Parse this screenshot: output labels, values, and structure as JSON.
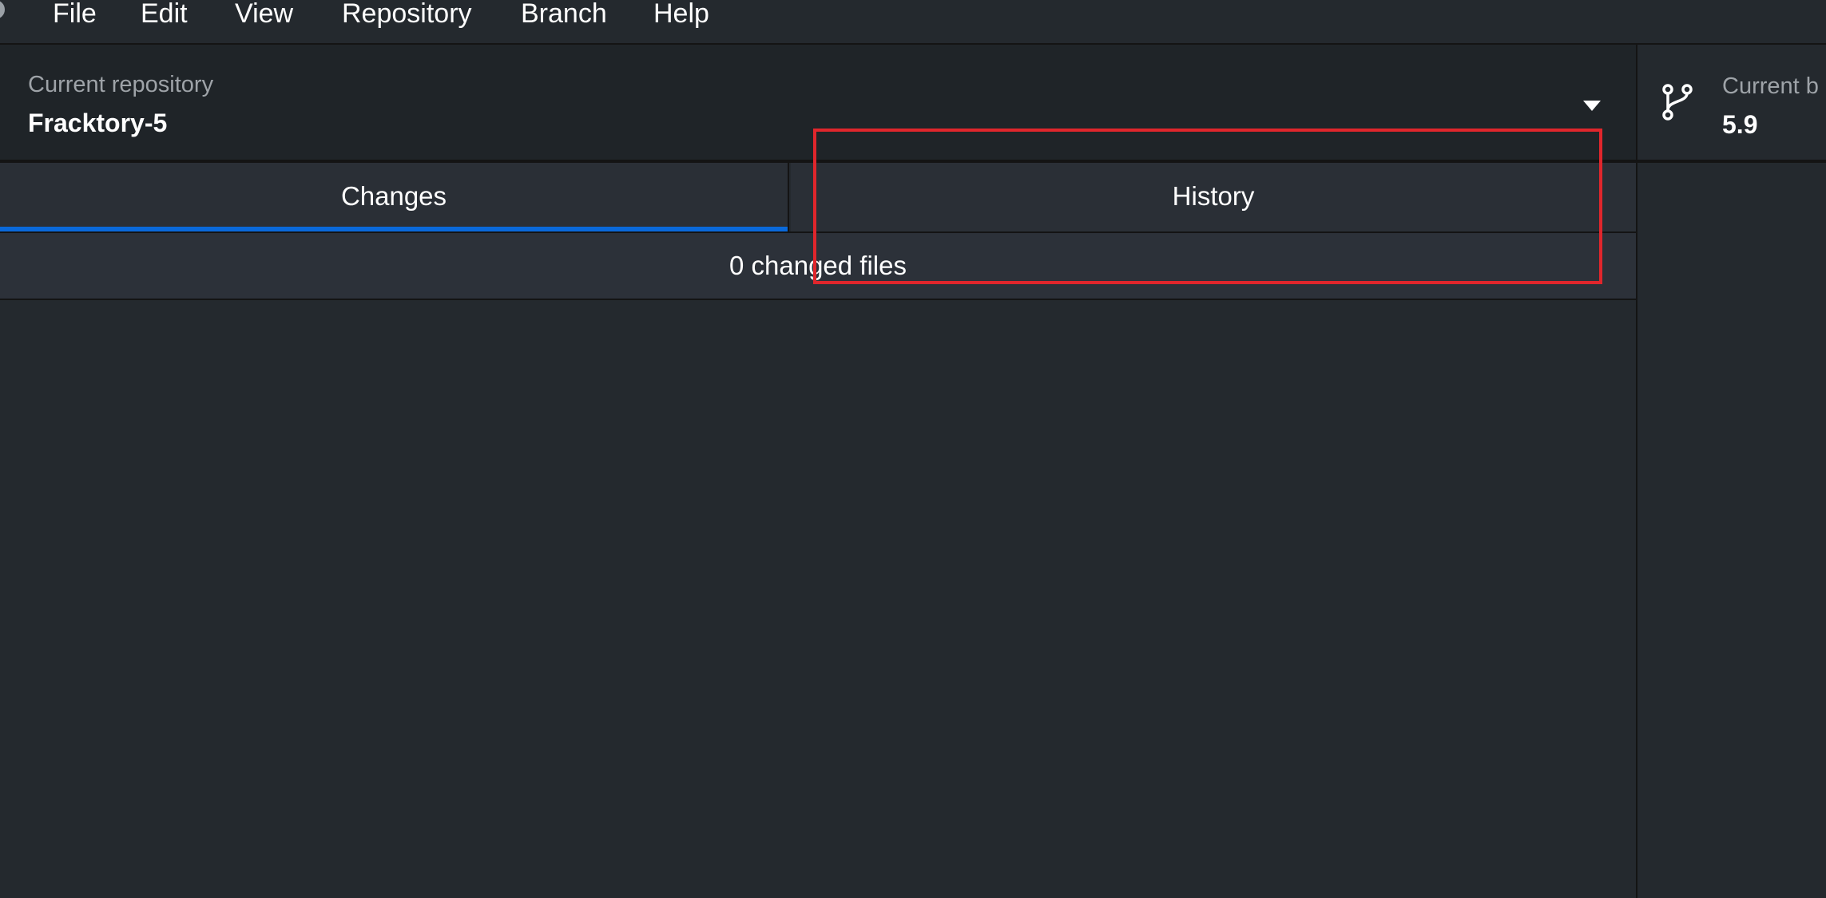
{
  "menubar": {
    "items": [
      {
        "id": "file",
        "label": "File"
      },
      {
        "id": "edit",
        "label": "Edit"
      },
      {
        "id": "view",
        "label": "View"
      },
      {
        "id": "repository",
        "label": "Repository"
      },
      {
        "id": "branch",
        "label": "Branch"
      },
      {
        "id": "help",
        "label": "Help"
      }
    ]
  },
  "toolbar": {
    "repository": {
      "label": "Current repository",
      "value": "Fracktory-5",
      "dropdown_icon": "caret-down-icon"
    },
    "branch": {
      "label": "Current b",
      "value": "5.9",
      "icon": "git-branch-icon"
    }
  },
  "tabs": [
    {
      "id": "changes",
      "label": "Changes",
      "selected": true
    },
    {
      "id": "history",
      "label": "History",
      "selected": false
    }
  ],
  "changes": {
    "summary": "0 changed files"
  },
  "colors": {
    "background": "#24292e",
    "tab_background": "#2a2f36",
    "selected_tab_underline": "#0a69da",
    "highlight_annotation": "#e0262c",
    "border": "#141414",
    "muted_text": "#9ea3a8"
  }
}
